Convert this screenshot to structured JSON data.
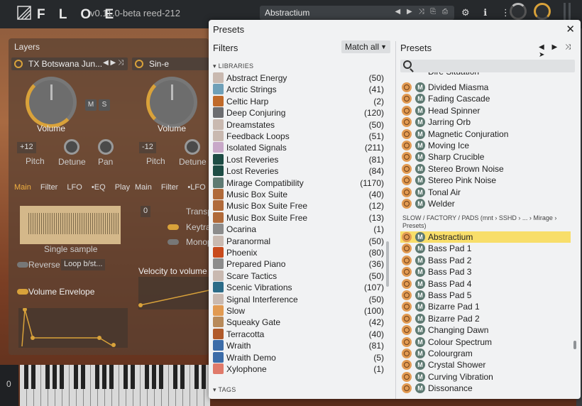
{
  "header": {
    "brand": "F L O E",
    "version": "v0.11.0-beta  reed-212",
    "preset_name": "Abstractium",
    "preset_icons": "◀ ▶ ⤨ ⎘ ⎙",
    "top_icons": "⚙ ℹ ⋮"
  },
  "layers": {
    "title": "Layers",
    "layer1": {
      "name": "TX Botswana Jun...",
      "controls": "◀ ▶ ⤨",
      "volume_label": "Volume",
      "m": "M",
      "s": "S",
      "pitch_value": "+12",
      "pitch_label": "Pitch",
      "detune_label": "Detune",
      "pan_label": "Pan",
      "tabs": [
        "Main",
        "Filter",
        "LFO",
        "•EQ",
        "Play"
      ],
      "waveform_label": "Single sample",
      "reverse_label": "Reverse",
      "loop_value": "Loop b/st...",
      "env_label": "Volume Envelope"
    },
    "layer2": {
      "name": "Sin-e",
      "volume_label": "Volume",
      "pitch_value": "-12",
      "pitch_label": "Pitch",
      "detune_label": "Detune",
      "tabs": [
        "Main",
        "Filter",
        "•LFO"
      ],
      "transpose_value": "0",
      "transpose_label": "Transp",
      "keytrack_label": "Keytra",
      "mono_label": "Monop",
      "velocity_label": "Velocity to volume c"
    },
    "keyboard_octave": "0"
  },
  "presets_panel": {
    "title": "Presets",
    "close": "✕",
    "filters": {
      "title": "Filters",
      "match_label": "Match all",
      "libraries_header": "LIBRARIES",
      "tags_header": "TAGS",
      "libraries": [
        {
          "name": "Abstract Energy",
          "count": "(50)",
          "color": "#c9b9b0"
        },
        {
          "name": "Arctic Strings",
          "count": "(41)",
          "color": "#6fa0b8"
        },
        {
          "name": "Celtic Harp",
          "count": "(2)",
          "color": "#c06a2a"
        },
        {
          "name": "Deep Conjuring",
          "count": "(120)",
          "color": "#6c6d70"
        },
        {
          "name": "Dreamstates",
          "count": "(50)",
          "color": "#c9b9b0"
        },
        {
          "name": "Feedback Loops",
          "count": "(51)",
          "color": "#c9b9b0"
        },
        {
          "name": "Isolated Signals",
          "count": "(211)",
          "color": "#c8a8c8"
        },
        {
          "name": "Lost Reveries",
          "count": "(81)",
          "color": "#1d4c44"
        },
        {
          "name": "Lost Reveries",
          "count": "(84)",
          "color": "#1d4c44"
        },
        {
          "name": "Mirage Compatibility",
          "count": "(1170)",
          "color": "#5e7a72"
        },
        {
          "name": "Music Box Suite",
          "count": "(40)",
          "color": "#b06a3a"
        },
        {
          "name": "Music Box Suite Free",
          "count": "(12)",
          "color": "#b06a3a"
        },
        {
          "name": "Music Box Suite Free",
          "count": "(13)",
          "color": "#b06a3a"
        },
        {
          "name": "Ocarina",
          "count": "(1)",
          "color": "#8c8c8c"
        },
        {
          "name": "Paranormal",
          "count": "(50)",
          "color": "#c9b9b0"
        },
        {
          "name": "Phoenix",
          "count": "(80)",
          "color": "#c84a1c"
        },
        {
          "name": "Prepared Piano",
          "count": "(36)",
          "color": "#8c8c8c"
        },
        {
          "name": "Scare Tactics",
          "count": "(50)",
          "color": "#c9b9b0"
        },
        {
          "name": "Scenic Vibrations",
          "count": "(107)",
          "color": "#2c6c88"
        },
        {
          "name": "Signal Interference",
          "count": "(50)",
          "color": "#c9b9b0"
        },
        {
          "name": "Slow",
          "count": "(100)",
          "color": "#e19a52"
        },
        {
          "name": "Squeaky Gate",
          "count": "(42)",
          "color": "#b88a5a"
        },
        {
          "name": "Terracotta",
          "count": "(40)",
          "color": "#b05a2a"
        },
        {
          "name": "Wraith",
          "count": "(81)",
          "color": "#3c6ca8"
        },
        {
          "name": "Wraith Demo",
          "count": "(5)",
          "color": "#3c6ca8"
        },
        {
          "name": "Xylophone",
          "count": "(1)",
          "color": "#e07a6a"
        }
      ]
    },
    "list": {
      "title": "Presets",
      "nav": "◀ ▶ ⤨ ➤",
      "search_placeholder": "",
      "partial_item": "Dire Situation",
      "items_top": [
        "Divided Miasma",
        "Fading Cascade",
        "Head Spinner",
        "Jarring Orb",
        "Magnetic Conjuration",
        "Moving Ice",
        "Sharp Crucible",
        "Stereo Brown Noise",
        "Stereo Pink Noise",
        "Tonal Air",
        "Welder"
      ],
      "category_header": "SLOW / FACTORY / PADS (mnt › SSHD › ... › Mirage › Presets)",
      "items_bottom": [
        "Abstractium",
        "Bass Pad 1",
        "Bass Pad 2",
        "Bass Pad 3",
        "Bass Pad 4",
        "Bass Pad 5",
        "Bizarre Pad 1",
        "Bizarre Pad 2",
        "Changing Dawn",
        "Colour Spectrum",
        "Colourgram",
        "Crystal Shower",
        "Curving Vibration",
        "Dissonance"
      ],
      "selected": "Abstractium",
      "badge": "M"
    }
  },
  "colors": {
    "accent": "#d9a23a",
    "selected_row": "#f8de6a",
    "slow_icon": "#e19a52",
    "mirage_badge": "#5e7a72"
  }
}
